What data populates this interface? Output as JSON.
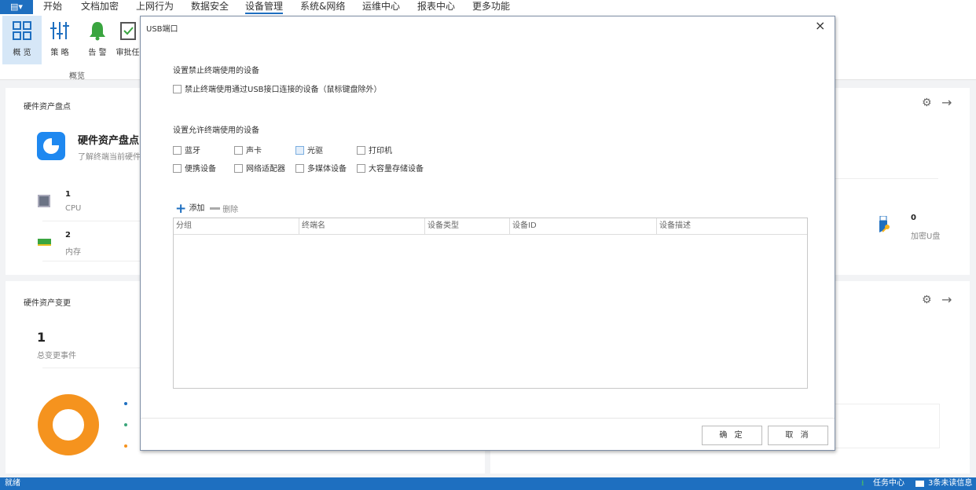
{
  "menubar": {
    "app_icon": "app-menu-icon",
    "items": [
      "开始",
      "文档加密",
      "上网行为",
      "数据安全",
      "设备管理",
      "系统&网络",
      "运维中心",
      "报表中心",
      "更多功能"
    ],
    "active": "设备管理"
  },
  "toolbar": {
    "items": [
      {
        "label": "概 览",
        "icon": "overview-grid-icon"
      },
      {
        "label": "策 略",
        "icon": "policy-sliders-icon"
      },
      {
        "label": "告 警",
        "icon": "alarm-bell-icon"
      },
      {
        "label": "审批任",
        "icon": "approval-check-icon"
      }
    ],
    "group_label": "概览"
  },
  "cards": {
    "inventory": {
      "title": "硬件资产盘点",
      "heading": "硬件资产盘点",
      "desc": "了解终端当前硬件",
      "items": [
        {
          "value": "1",
          "label": "CPU",
          "icon": "cpu-icon"
        },
        {
          "value": "2",
          "label": "内存",
          "icon": "memory-icon"
        }
      ],
      "usb": {
        "value": "0",
        "label": "加密U盘",
        "icon": "encrypted-usb-icon"
      }
    },
    "changes": {
      "title": "硬件资产变更",
      "total": "1",
      "total_label": "总变更事件",
      "legend_colors": [
        "#1e6fc0",
        "#3aa57a",
        "#f5931e"
      ],
      "donut_color": "#f5931e"
    }
  },
  "dialog": {
    "title": "USB端口",
    "close": "×",
    "forbid_section": "设置禁止终端使用的设备",
    "forbid_option": "禁止终端使用通过USB接口连接的设备（鼠标键盘除外）",
    "allow_section": "设置允许终端使用的设备",
    "allow_options": [
      "蓝牙",
      "声卡",
      "光驱",
      "打印机",
      "便携设备",
      "网络适配器",
      "多媒体设备",
      "大容量存储设备"
    ],
    "add": "添加",
    "remove": "删除",
    "columns": [
      "分组",
      "终端名",
      "设备类型",
      "设备ID",
      "设备描述"
    ],
    "rows": [],
    "ok": "确 定",
    "cancel": "取 消"
  },
  "status": {
    "left": "就绪",
    "tasks": "任务中心",
    "messages": "3条未读信息"
  },
  "colors": {
    "accent": "#1e6fc0",
    "plus": "#1e6fc0"
  }
}
